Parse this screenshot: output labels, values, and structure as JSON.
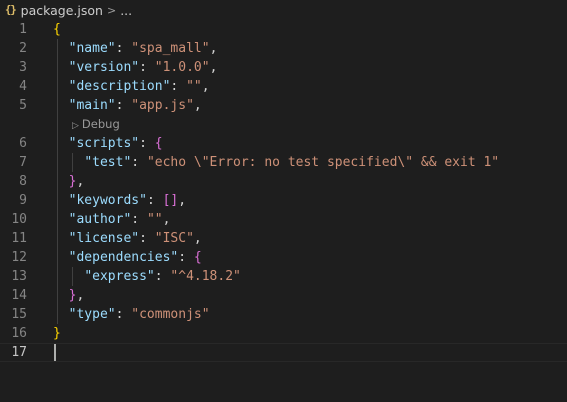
{
  "breadcrumb": {
    "icon_text": "{}",
    "file": "package.json",
    "chevron": ">",
    "more": "..."
  },
  "codelens": {
    "label": "Debug"
  },
  "lines": [
    {
      "n": "1",
      "tokens": [
        [
          "b1",
          "{"
        ]
      ]
    },
    {
      "n": "2",
      "tokens": [
        [
          "p",
          "  "
        ],
        [
          "k",
          "\"name\""
        ],
        [
          "p",
          ": "
        ],
        [
          "s",
          "\"spa_mall\""
        ],
        [
          "p",
          ","
        ]
      ]
    },
    {
      "n": "3",
      "tokens": [
        [
          "p",
          "  "
        ],
        [
          "k",
          "\"version\""
        ],
        [
          "p",
          ": "
        ],
        [
          "s",
          "\"1.0.0\""
        ],
        [
          "p",
          ","
        ]
      ]
    },
    {
      "n": "4",
      "tokens": [
        [
          "p",
          "  "
        ],
        [
          "k",
          "\"description\""
        ],
        [
          "p",
          ": "
        ],
        [
          "s",
          "\"\""
        ],
        [
          "p",
          ","
        ]
      ]
    },
    {
      "n": "5",
      "tokens": [
        [
          "p",
          "  "
        ],
        [
          "k",
          "\"main\""
        ],
        [
          "p",
          ": "
        ],
        [
          "s",
          "\"app.js\""
        ],
        [
          "p",
          ","
        ]
      ]
    },
    {
      "n": "6",
      "tokens": [
        [
          "p",
          "  "
        ],
        [
          "k",
          "\"scripts\""
        ],
        [
          "p",
          ": "
        ],
        [
          "b2",
          "{"
        ]
      ]
    },
    {
      "n": "7",
      "tokens": [
        [
          "p",
          "    "
        ],
        [
          "k",
          "\"test\""
        ],
        [
          "p",
          ": "
        ],
        [
          "s",
          "\"echo \\\"Error: no test specified\\\" && exit 1\""
        ]
      ]
    },
    {
      "n": "8",
      "tokens": [
        [
          "p",
          "  "
        ],
        [
          "b2",
          "}"
        ],
        [
          "p",
          ","
        ]
      ]
    },
    {
      "n": "9",
      "tokens": [
        [
          "p",
          "  "
        ],
        [
          "k",
          "\"keywords\""
        ],
        [
          "p",
          ": "
        ],
        [
          "b2",
          "[]"
        ],
        [
          "p",
          ","
        ]
      ]
    },
    {
      "n": "10",
      "tokens": [
        [
          "p",
          "  "
        ],
        [
          "k",
          "\"author\""
        ],
        [
          "p",
          ": "
        ],
        [
          "s",
          "\"\""
        ],
        [
          "p",
          ","
        ]
      ]
    },
    {
      "n": "11",
      "tokens": [
        [
          "p",
          "  "
        ],
        [
          "k",
          "\"license\""
        ],
        [
          "p",
          ": "
        ],
        [
          "s",
          "\"ISC\""
        ],
        [
          "p",
          ","
        ]
      ]
    },
    {
      "n": "12",
      "tokens": [
        [
          "p",
          "  "
        ],
        [
          "k",
          "\"dependencies\""
        ],
        [
          "p",
          ": "
        ],
        [
          "b2",
          "{"
        ]
      ]
    },
    {
      "n": "13",
      "tokens": [
        [
          "p",
          "    "
        ],
        [
          "k",
          "\"express\""
        ],
        [
          "p",
          ": "
        ],
        [
          "s",
          "\"^4.18.2\""
        ]
      ]
    },
    {
      "n": "14",
      "tokens": [
        [
          "p",
          "  "
        ],
        [
          "b2",
          "}"
        ],
        [
          "p",
          ","
        ]
      ]
    },
    {
      "n": "15",
      "tokens": [
        [
          "p",
          "  "
        ],
        [
          "k",
          "\"type\""
        ],
        [
          "p",
          ": "
        ],
        [
          "s",
          "\"commonjs\""
        ]
      ]
    },
    {
      "n": "16",
      "tokens": [
        [
          "b1",
          "}"
        ]
      ]
    },
    {
      "n": "17",
      "tokens": []
    }
  ],
  "colors": {
    "background": "#1e1e1e",
    "key": "#9cdcfe",
    "string": "#ce9178",
    "bracket_level1": "#ffd700",
    "bracket_level2": "#da70d6",
    "line_number": "#858585"
  }
}
